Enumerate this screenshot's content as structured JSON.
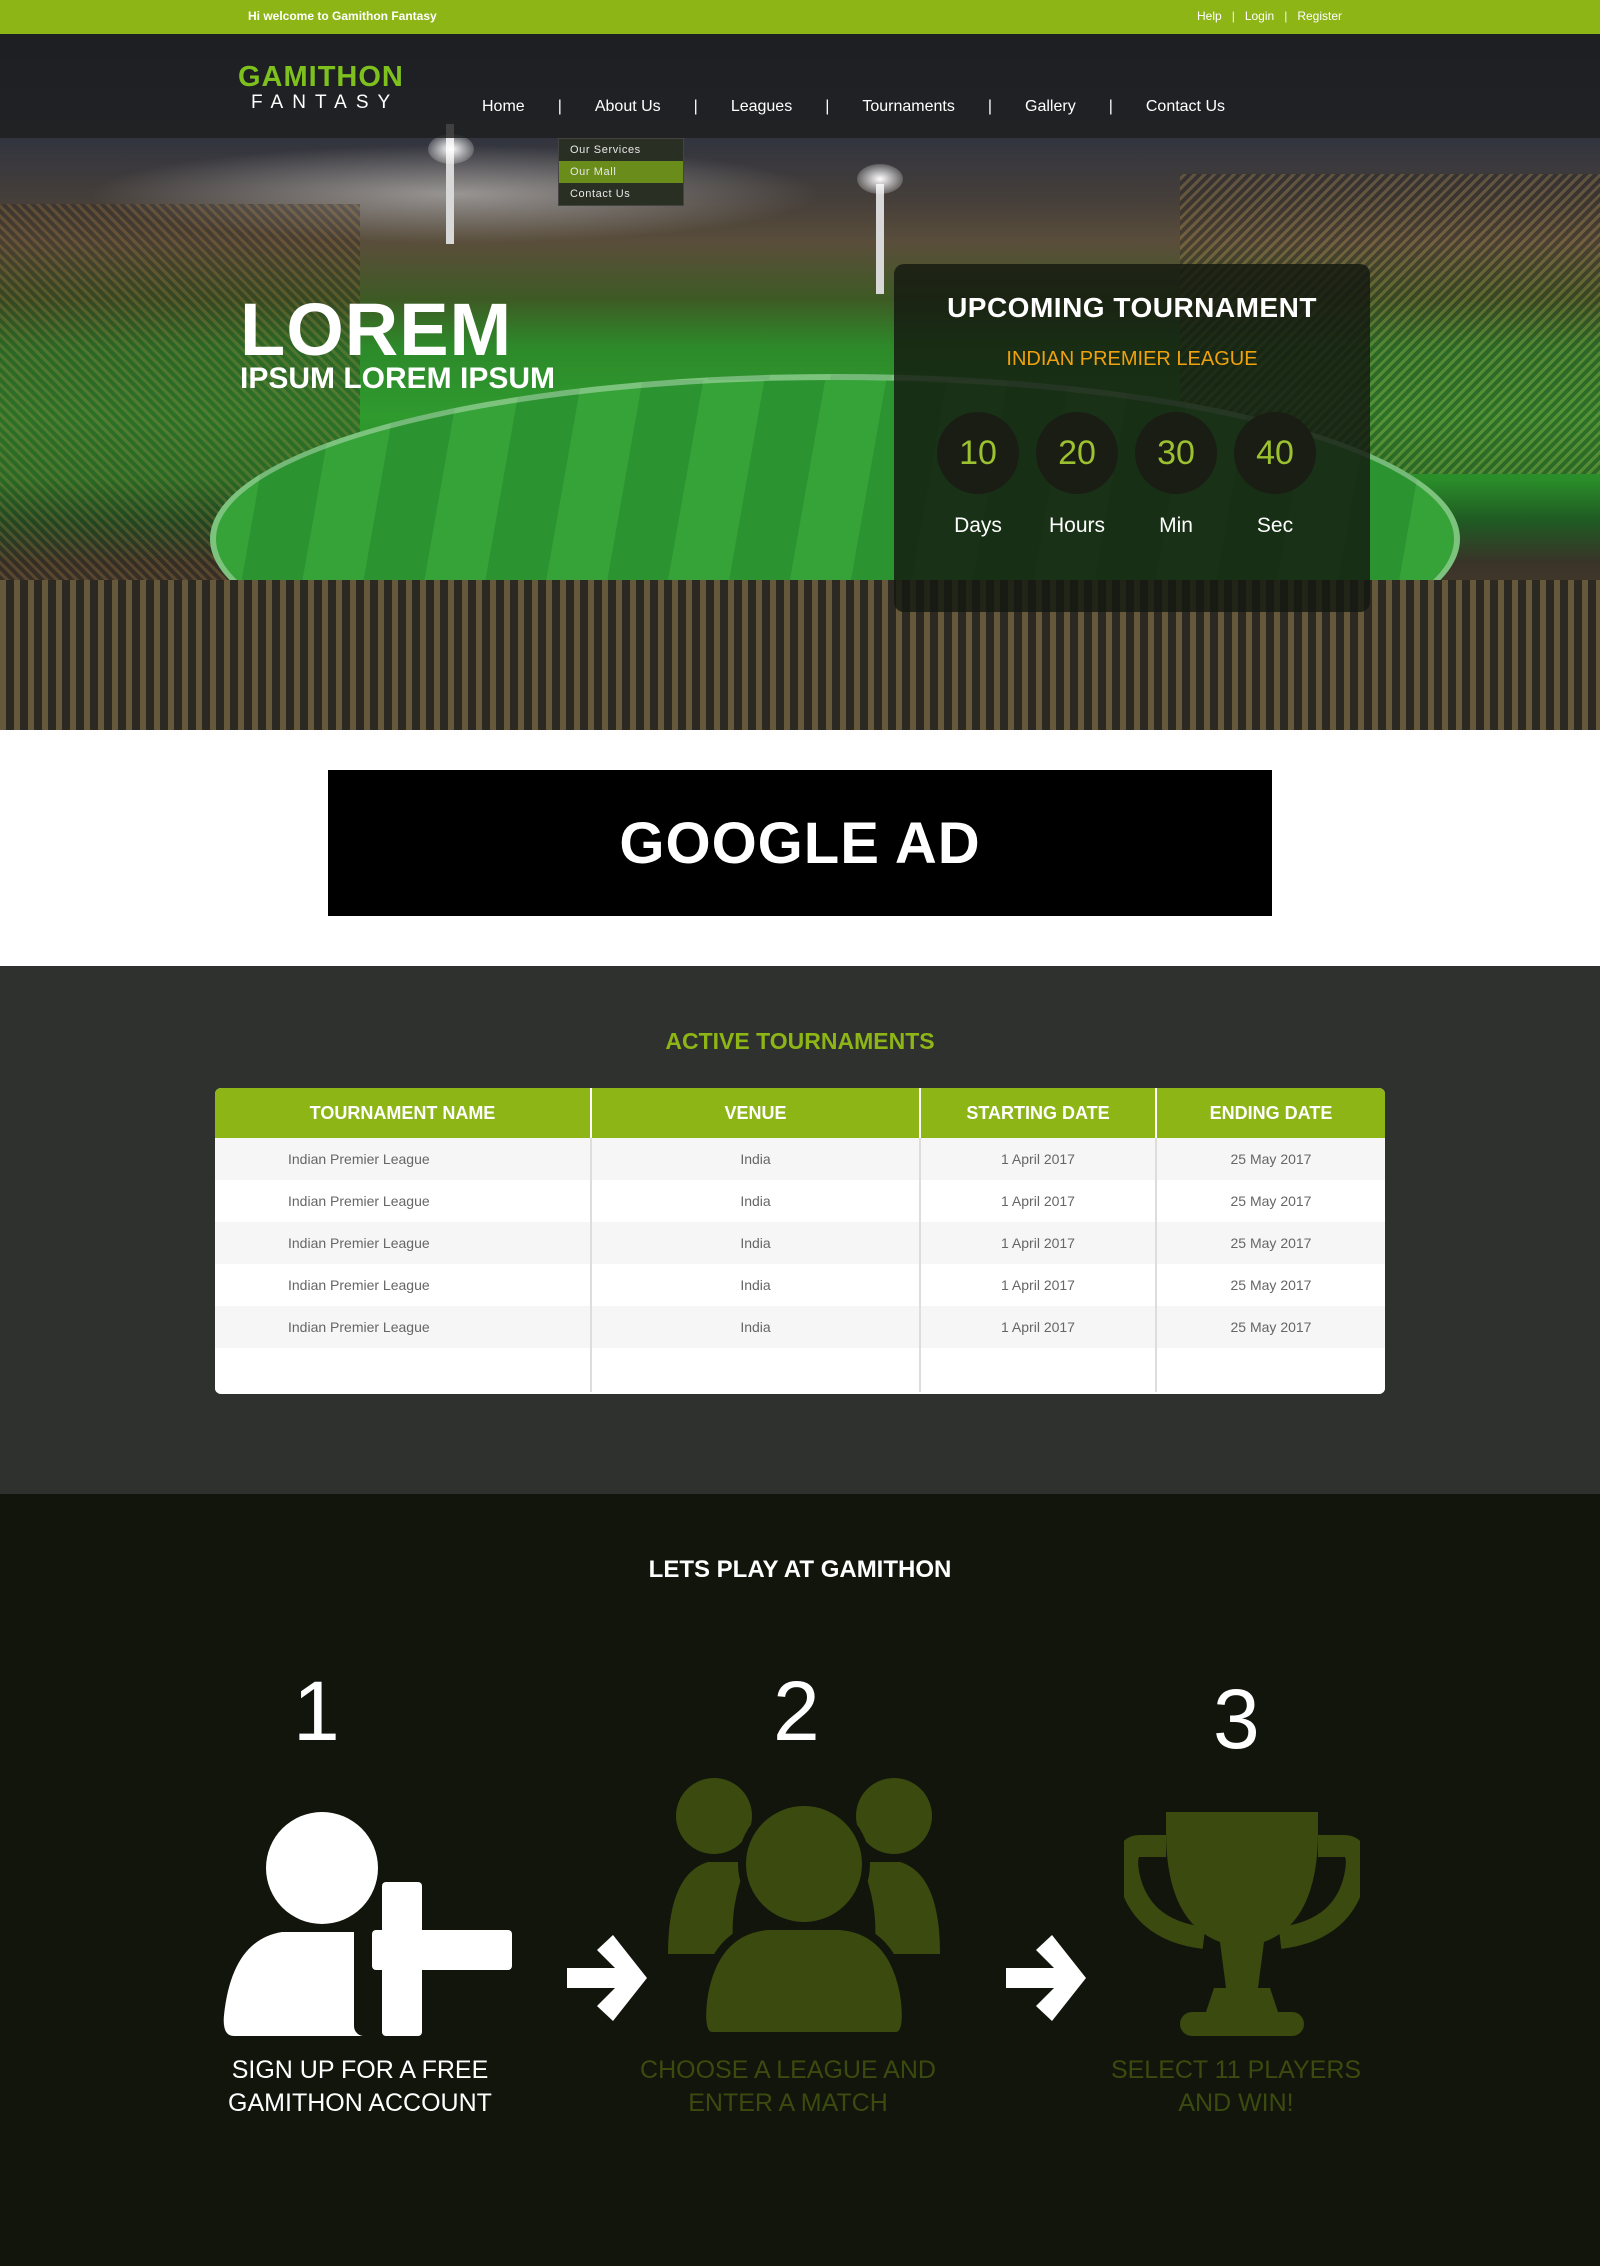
{
  "topbar": {
    "welcome": "Hi welcome to Gamithon Fantasy",
    "help": "Help",
    "login": "Login",
    "register": "Register",
    "sep": "|"
  },
  "logo": {
    "line1": "GAMITHON",
    "line2": "FANTASY"
  },
  "nav": {
    "items": [
      "Home",
      "About Us",
      "Leagues",
      "Tournaments",
      "Gallery",
      "Contact Us"
    ],
    "separator": "|",
    "dropdown": [
      "Our Services",
      "Our Mall",
      "Contact Us"
    ],
    "dropdown_active": "Our Mall"
  },
  "hero": {
    "title": "LOREM",
    "subtitle": "IPSUM LOREM IPSUM"
  },
  "countdown": {
    "heading": "UPCOMING TOURNAMENT",
    "league": "INDIAN PREMIER LEAGUE",
    "units": [
      {
        "value": "10",
        "label": "Days"
      },
      {
        "value": "20",
        "label": "Hours"
      },
      {
        "value": "30",
        "label": "Min"
      },
      {
        "value": "40",
        "label": "Sec"
      }
    ]
  },
  "ad": {
    "text": "GOOGLE AD"
  },
  "tournaments": {
    "title": "ACTIVE TOURNAMENTS",
    "columns": [
      "TOURNAMENT NAME",
      "VENUE",
      "STARTING DATE",
      "ENDING DATE"
    ],
    "rows": [
      [
        "Indian Premier League",
        "India",
        "1 April 2017",
        "25 May 2017"
      ],
      [
        "Indian Premier League",
        "India",
        "1 April 2017",
        "25 May 2017"
      ],
      [
        "Indian Premier League",
        "India",
        "1 April 2017",
        "25 May 2017"
      ],
      [
        "Indian Premier League",
        "India",
        "1 April 2017",
        "25 May 2017"
      ],
      [
        "Indian Premier League",
        "India",
        "1 April 2017",
        "25 May 2017"
      ]
    ]
  },
  "steps": {
    "title": "LETS PLAY AT GAMITHON",
    "items": [
      {
        "number": "1",
        "caption": "SIGN UP FOR A FREE GAMITHON ACCOUNT",
        "icon": "add-user-icon"
      },
      {
        "number": "2",
        "caption": "CHOOSE A LEAGUE AND ENTER A MATCH",
        "icon": "group-icon"
      },
      {
        "number": "3",
        "caption": "SELECT 11 PLAYERS AND WIN!",
        "icon": "trophy-icon"
      }
    ]
  },
  "colors": {
    "brand_green": "#8db516",
    "dim_green": "#3b4a0e",
    "accent_orange": "#f0a20e",
    "dark_bg": "#12150c"
  }
}
